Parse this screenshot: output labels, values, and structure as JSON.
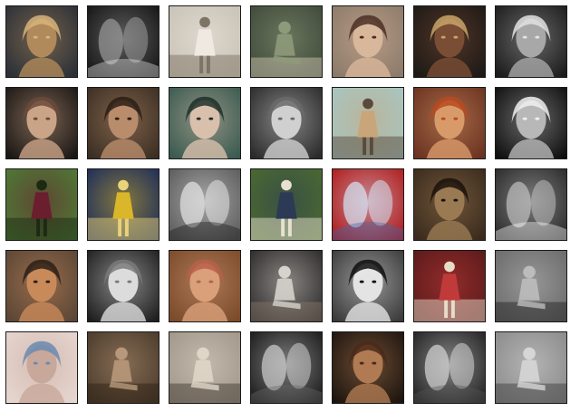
{
  "gallery": {
    "tiles": [
      {
        "name": "portrait-woman-gold-headdress",
        "bg": "#2a2f38",
        "fg": "#b08a5a",
        "accent": "#d7b47a",
        "motif": "face"
      },
      {
        "name": "bw-figure-abstract",
        "bg": "#141414",
        "fg": "#9a9a9a",
        "accent": "#e8e8e8",
        "motif": "abstract"
      },
      {
        "name": "woman-white-dress-corridor",
        "bg": "#c9c2b6",
        "fg": "#efe9e2",
        "accent": "#7e7466",
        "motif": "standing"
      },
      {
        "name": "nude-figure-window",
        "bg": "#3f4a3a",
        "fg": "#8e9a7a",
        "accent": "#d9cfb8",
        "motif": "seated"
      },
      {
        "name": "portrait-young-woman-soft",
        "bg": "#8c7a6a",
        "fg": "#d9b79a",
        "accent": "#4a2f24",
        "motif": "face"
      },
      {
        "name": "portrait-woman-braids",
        "bg": "#1d1916",
        "fg": "#7a4d35",
        "accent": "#c9a468",
        "motif": "face"
      },
      {
        "name": "bw-portrait-smiling-woman",
        "bg": "#1b1b1b",
        "fg": "#a8a8a8",
        "accent": "#e2e2e2",
        "motif": "face"
      },
      {
        "name": "portrait-woman-headpiece",
        "bg": "#1a1614",
        "fg": "#caa487",
        "accent": "#6a4a38",
        "motif": "face"
      },
      {
        "name": "portrait-hand-on-face",
        "bg": "#3a2e22",
        "fg": "#b98c6c",
        "accent": "#2c1e15",
        "motif": "face"
      },
      {
        "name": "woman-teal-backdrop",
        "bg": "#395a4f",
        "fg": "#d8c0ad",
        "accent": "#1f302a",
        "motif": "face"
      },
      {
        "name": "bw-woman-lying",
        "bg": "#2a2a2a",
        "fg": "#d0d0d0",
        "accent": "#6a6a6a",
        "motif": "face"
      },
      {
        "name": "girl-on-beach",
        "bg": "#a7c6c2",
        "fg": "#c9a67a",
        "accent": "#5a4a3a",
        "motif": "standing"
      },
      {
        "name": "portrait-red-hair",
        "bg": "#6a3220",
        "fg": "#d99a6a",
        "accent": "#b84a20",
        "motif": "face"
      },
      {
        "name": "bw-screaming-man",
        "bg": "#0e0e0e",
        "fg": "#b8b8b8",
        "accent": "#f0f0f0",
        "motif": "face"
      },
      {
        "name": "dancer-in-garden",
        "bg": "#4e7a36",
        "fg": "#6a1e2e",
        "accent": "#1c2a14",
        "motif": "standing"
      },
      {
        "name": "woman-yellow-doorway",
        "bg": "#1c2c5a",
        "fg": "#d9b62a",
        "accent": "#e8d27a",
        "motif": "standing"
      },
      {
        "name": "bw-blurred-smile",
        "bg": "#5a5a5a",
        "fg": "#e6e6e6",
        "accent": "#1a1a1a",
        "motif": "abstract"
      },
      {
        "name": "woman-in-park",
        "bg": "#4a6a30",
        "fg": "#2c3a56",
        "accent": "#e8e0d0",
        "motif": "standing"
      },
      {
        "name": "blurred-dancer-red",
        "bg": "#b01a1a",
        "fg": "#d6e6f6",
        "accent": "#3a6ab0",
        "motif": "abstract"
      },
      {
        "name": "man-hat-sunglasses-fur",
        "bg": "#3a2a1c",
        "fg": "#9a7a52",
        "accent": "#1a120c",
        "motif": "face"
      },
      {
        "name": "bw-multiple-faces",
        "bg": "#2a2a2a",
        "fg": "#c0c0c0",
        "accent": "#ffffff",
        "motif": "abstract"
      },
      {
        "name": "two-women-redhead",
        "bg": "#5a4636",
        "fg": "#c98a5a",
        "accent": "#2a1e16",
        "motif": "face"
      },
      {
        "name": "bw-woman-smiling-low",
        "bg": "#1e1e1e",
        "fg": "#dcdcdc",
        "accent": "#7a7a7a",
        "motif": "face"
      },
      {
        "name": "woman-among-flowers",
        "bg": "#7a4a2a",
        "fg": "#d9a07a",
        "accent": "#b8604a",
        "motif": "face"
      },
      {
        "name": "hands-holding-photo",
        "bg": "#2c2a2a",
        "fg": "#d6d2cc",
        "accent": "#8a7a6a",
        "motif": "seated"
      },
      {
        "name": "bw-child-cap",
        "bg": "#3a3a3a",
        "fg": "#e4e4e4",
        "accent": "#0f0f0f",
        "motif": "face"
      },
      {
        "name": "two-girls-red-dresses",
        "bg": "#5a1a1a",
        "fg": "#c03a3a",
        "accent": "#e8dcc8",
        "motif": "standing"
      },
      {
        "name": "bw-seated-woman-stairs",
        "bg": "#6a6a6a",
        "fg": "#bcbcbc",
        "accent": "#202020",
        "motif": "seated"
      },
      {
        "name": "closeup-eye-rope",
        "bg": "#e6d6d0",
        "fg": "#c8a89a",
        "accent": "#6a8ab0",
        "motif": "face"
      },
      {
        "name": "sepia-seated-woman",
        "bg": "#4a3a2a",
        "fg": "#b8987a",
        "accent": "#2a1e14",
        "motif": "seated"
      },
      {
        "name": "sepia-seated-legs",
        "bg": "#a0968a",
        "fg": "#e0d6c8",
        "accent": "#3a3028",
        "motif": "seated"
      },
      {
        "name": "bw-triple-face",
        "bg": "#1a1a1a",
        "fg": "#cfcfcf",
        "accent": "#6a6a6a",
        "motif": "abstract"
      },
      {
        "name": "portrait-freckled-child",
        "bg": "#1c140e",
        "fg": "#b07a52",
        "accent": "#4a2a1a",
        "motif": "face"
      },
      {
        "name": "bw-quad-faces-hands",
        "bg": "#222222",
        "fg": "#d6d6d6",
        "accent": "#555555",
        "motif": "abstract"
      },
      {
        "name": "bw-reclining-figures",
        "bg": "#8a8a8a",
        "fg": "#d6d6d6",
        "accent": "#3a3a3a",
        "motif": "seated"
      }
    ]
  }
}
